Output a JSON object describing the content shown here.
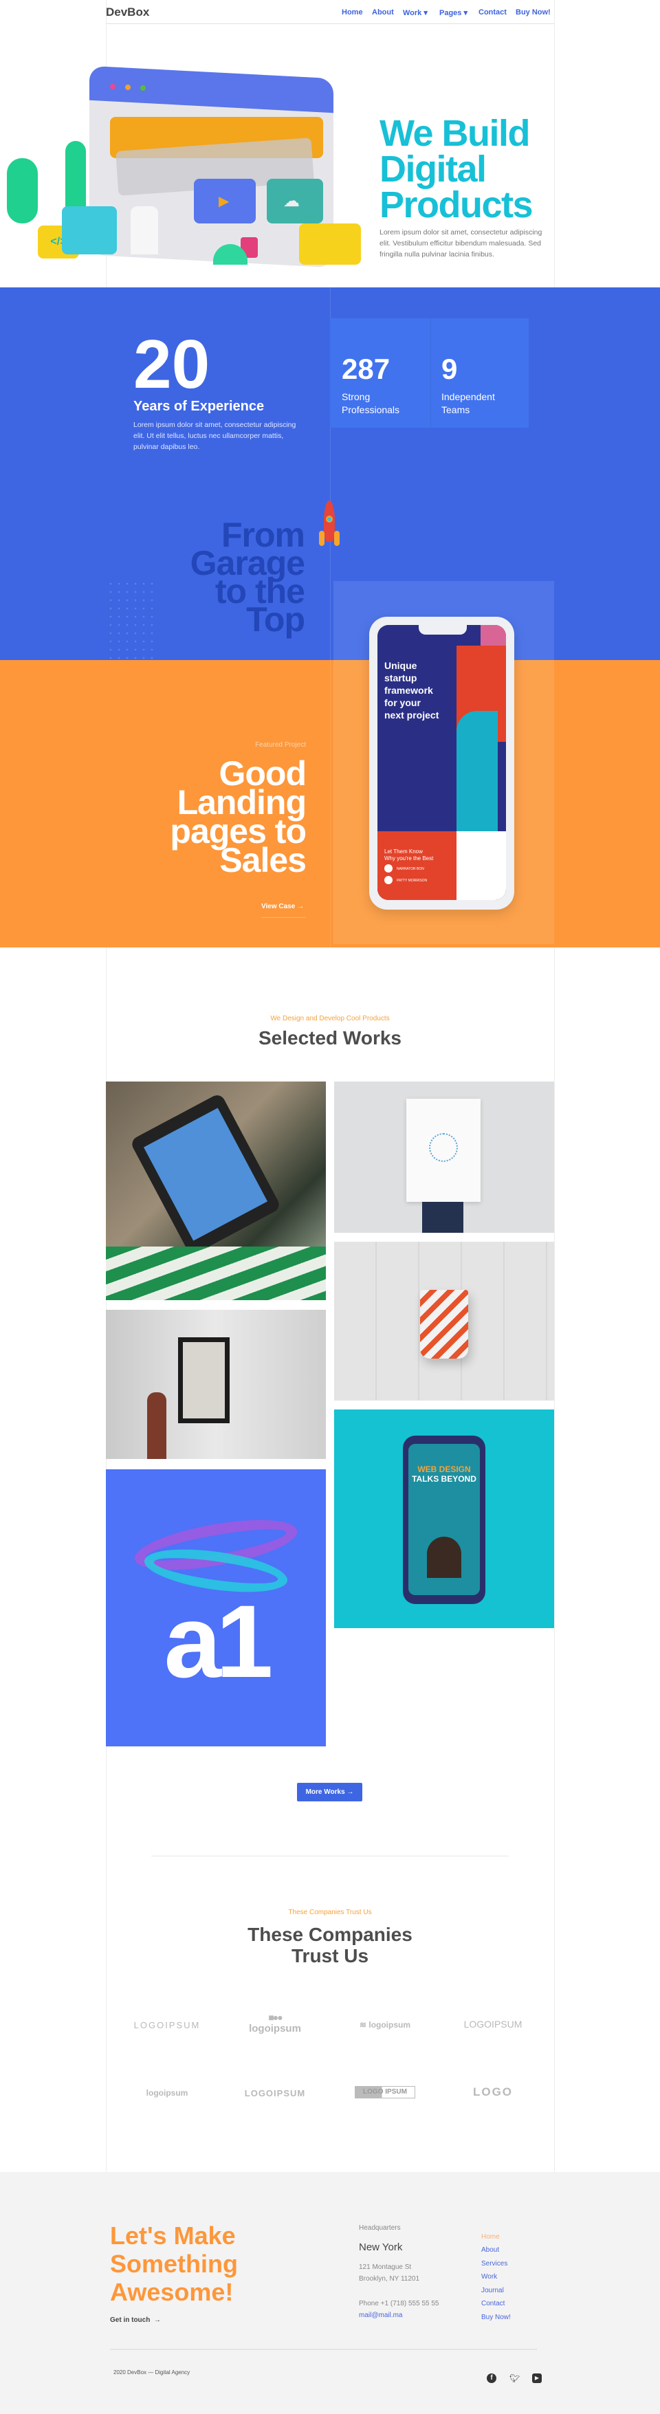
{
  "header": {
    "logo": "DevBox",
    "nav": [
      {
        "label": "Home"
      },
      {
        "label": "About"
      },
      {
        "label": "Work ▾"
      },
      {
        "label": "Pages ▾"
      },
      {
        "label": "Contact"
      },
      {
        "label": "Buy Now!"
      }
    ]
  },
  "hero": {
    "title_lines": [
      "We Build",
      "Digital",
      "Products"
    ],
    "text": "Lorem ipsum dolor sit amet, consectetur adipiscing elit. Vestibulum efficitur bibendum malesuada. Sed fringilla nulla pulvinar lacinia finibus.",
    "accent": "#17c0d6"
  },
  "stats": {
    "years": "20",
    "years_label": "Years of Experience",
    "years_text": "Lorem ipsum dolor sit amet, consectetur adipiscing elit. Ut elit tellus, luctus nec ullamcorper mattis, pulvinar dapibus leo.",
    "items": [
      {
        "value": "287",
        "label_lines": [
          "Strong",
          "Professionals"
        ]
      },
      {
        "value": "9",
        "label_lines": [
          "Independent",
          "Teams"
        ]
      }
    ],
    "slogan_lines": [
      "From",
      "Garage",
      "to the",
      "Top"
    ],
    "color": "#3e66e3"
  },
  "featured": {
    "eyebrow": "Featured Project",
    "title_lines": [
      "Good",
      "Landing",
      "pages to",
      "Sales"
    ],
    "cta": "View Case",
    "phone": {
      "headline_lines": [
        "Unique",
        "startup",
        "framework",
        "for your",
        "next project"
      ],
      "tagline_lines": [
        "Let Them Know",
        "Why you're the Best"
      ],
      "people": [
        "NARRATOR BON",
        "PATTY MORRISON"
      ]
    },
    "color": "#fd973a"
  },
  "works": {
    "eyebrow": "We Design and Develop Cool Products",
    "title": "Selected Works",
    "phone_card_lines": [
      "WEB DESIGN",
      "TALKS BEYOND"
    ],
    "poster_text": "a1",
    "more": "More Works"
  },
  "trust": {
    "eyebrow": "These Companies Trust Us",
    "title_lines": [
      "These Companies",
      "Trust Us"
    ],
    "logos": [
      "LOGOIPSUM",
      "logoipsum",
      "logoipsum",
      "LOGOIPSUM",
      "logoipsum",
      "LOGOIPSUM",
      "LOGO IPSUM",
      "LOGO"
    ]
  },
  "footer": {
    "title_lines": [
      "Let's Make",
      "Something",
      "Awesome!"
    ],
    "cta": "Get in touch",
    "hq_label": "Headquarters",
    "city": "New York",
    "address_lines": [
      "121 Montague St",
      "Brooklyn, NY 11201"
    ],
    "phone": "Phone +1 (718) 555 55 55",
    "email": "mail@mail.ma",
    "links": [
      {
        "label": "Home",
        "active": true
      },
      {
        "label": "About"
      },
      {
        "label": "Services"
      },
      {
        "label": "Work"
      },
      {
        "label": "Journal"
      },
      {
        "label": "Contact"
      },
      {
        "label": "Buy Now!"
      }
    ],
    "copyright": "2020 DevBox — Digital Agency",
    "social": [
      "facebook-icon",
      "twitter-icon",
      "youtube-icon"
    ],
    "accent": "#fd973a"
  }
}
